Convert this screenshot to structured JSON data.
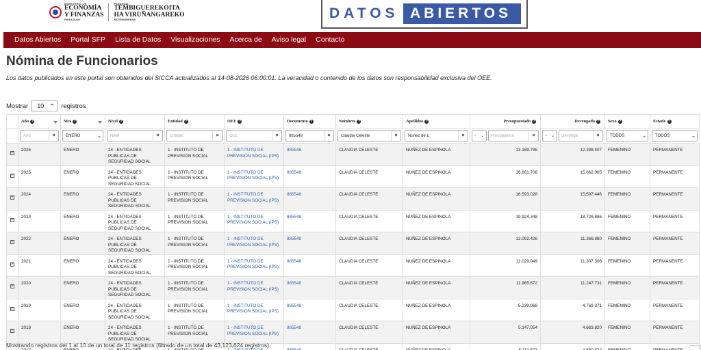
{
  "header": {
    "mef_small": "MINISTERIO DE",
    "mef_line1": "ECONOMÍA",
    "mef_line2": "Y FINANZAS",
    "mef_country": "PARAGUAY",
    "guar_small": "PARAGUÁI",
    "guar_line1": "TEMBIGUEREKOITA",
    "guar_line2": "HA VIRUÑANGAREKO",
    "guar_foot": "MOTENONDEHA",
    "banner_word1": "DATOS",
    "banner_word2": "ABIERTOS"
  },
  "nav": [
    "Datos Abiertos",
    "Portal SFP",
    "Lista de Datos",
    "Visualizaciones",
    "Acerca de",
    "Aviso legal",
    "Contacto"
  ],
  "page": {
    "title": "Nómina de Funcionarios",
    "description": "Los datos publicados en este portal son obtenidos del SICCA actualizados al 14-08-2026 06:00:01. La veracidad o contenido de los datos son responsabilidad exclusiva del OEE.",
    "show_label": "Mostrar",
    "show_value": "10",
    "show_suffix": "registros",
    "info": "Mostrando registros del 1 al 10 de un total de 11 registros (filtrado de un total de 43,123,624 registros)."
  },
  "columns": [
    "Año",
    "Mes",
    "Nivel",
    "Entidad",
    "OEE",
    "Documento",
    "Nombres",
    "Apellidos",
    "Presupuestado",
    "Devengado",
    "Sexo",
    "Estado"
  ],
  "filters": {
    "anio_placeholder": "Año",
    "mes_value": "ENERO",
    "nivel_placeholder": "Nivel",
    "entidad_placeholder": "Entidad",
    "oee_placeholder": "OEE",
    "documento_value": "885548",
    "nombres_value": "Claudia Celeste",
    "apellidos_value": "Nuñez de E",
    "presupuestado_op": "=",
    "presupuestado_placeholder": "Presupuesta",
    "devengado_op": "=",
    "devengado_placeholder": "Devenga",
    "sexo_value": "TODOS",
    "estado_value": "TODOS"
  },
  "rows": [
    {
      "anio": "2026",
      "mes": "ENERO",
      "nivel": "24 - ENTIDADES PUBLICAS DE SEGURIDAD SOCIAL",
      "entidad": "1 - INSTITUTO DE PREVISION SOCIAL",
      "oee": "1 - INSTITUTO DE PREVISION SOCIAL (IPS)",
      "documento": "885548",
      "nombres": "CLAUDIA CELESTE",
      "apellidos": "NUÑEZ DE ESPINOLA",
      "presupuestado": "13.189.795",
      "devengado": "12.398.407",
      "sexo": "FEMENINO",
      "estado": "PERMANENTE"
    },
    {
      "anio": "2025",
      "mes": "ENERO",
      "nivel": "24 - ENTIDADES PUBLICAS DE SEGURIDAD SOCIAL",
      "entidad": "1 - INSTITUTO DE PREVISION SOCIAL",
      "oee": "1 - INSTITUTO DE PREVISION SOCIAL (IPS)",
      "documento": "885548",
      "nombres": "CLAUDIA CELESTE",
      "apellidos": "NUÑEZ DE ESPINOLA",
      "presupuestado": "16.661.708",
      "devengado": "15.662.005",
      "sexo": "FEMENINO",
      "estado": "PERMANENTE"
    },
    {
      "anio": "2024",
      "mes": "ENERO",
      "nivel": "24 - ENTIDADES PUBLICAS DE SEGURIDAD SOCIAL",
      "entidad": "1 - INSTITUTO DE PREVISION SOCIAL",
      "oee": "1 - INSTITUTO DE PREVISION SOCIAL (IPS)",
      "documento": "885548",
      "nombres": "CLAUDIA CELESTE",
      "apellidos": "NUÑEZ DE ESPINOLA",
      "presupuestado": "16.593.028",
      "devengado": "15.597.446",
      "sexo": "FEMENINO",
      "estado": "PERMANENTE"
    },
    {
      "anio": "2023",
      "mes": "ENERO",
      "nivel": "24 - ENTIDADES PUBLICAS DE SEGURIDAD SOCIAL",
      "entidad": "1 - INSTITUTO DE PREVISION SOCIAL",
      "oee": "1 - INSTITUTO DE PREVISION SOCIAL (IPS)",
      "documento": "885548",
      "nombres": "CLAUDIA CELESTE",
      "apellidos": "NUÑEZ DE ESPINOLA",
      "presupuestado": "19.924.348",
      "devengado": "18.728.886",
      "sexo": "FEMENINO",
      "estado": "PERMANENTE"
    },
    {
      "anio": "2022",
      "mes": "ENERO",
      "nivel": "24 - ENTIDADES PUBLICAS DE SEGURIDAD SOCIAL",
      "entidad": "1 - INSTITUTO DE PREVISION SOCIAL",
      "oee": "1 - INSTITUTO DE PREVISION SOCIAL (IPS)",
      "documento": "885548",
      "nombres": "CLAUDIA CELESTE",
      "apellidos": "NUÑEZ DE ESPINOLA",
      "presupuestado": "12.092.426",
      "devengado": "11.366.880",
      "sexo": "FEMENINO",
      "estado": "PERMANENTE"
    },
    {
      "anio": "2021",
      "mes": "ENERO",
      "nivel": "24 - ENTIDADES PUBLICAS DE SEGURIDAD SOCIAL",
      "entidad": "1 - INSTITUTO DE PREVISION SOCIAL",
      "oee": "1 - INSTITUTO DE PREVISION SOCIAL (IPS)",
      "documento": "885548",
      "nombres": "CLAUDIA CELESTE",
      "apellidos": "NUÑEZ DE ESPINOLA",
      "presupuestado": "12.029.049",
      "devengado": "11.307.306",
      "sexo": "FEMENINO",
      "estado": "PERMANENTE"
    },
    {
      "anio": "2020",
      "mes": "ENERO",
      "nivel": "24 - ENTIDADES PUBLICAS DE SEGURIDAD SOCIAL",
      "entidad": "1 - INSTITUTO DE PREVISION SOCIAL",
      "oee": "1 - INSTITUTO DE PREVISION SOCIAL (IPS)",
      "documento": "885548",
      "nombres": "CLAUDIA CELESTE",
      "apellidos": "NUÑEZ DE ESPINOLA",
      "presupuestado": "11.965.672",
      "devengado": "11.247.731",
      "sexo": "FEMENINO",
      "estado": "PERMANENTE"
    },
    {
      "anio": "2019",
      "mes": "ENERO",
      "nivel": "24 - ENTIDADES PUBLICAS DE SEGURIDAD SOCIAL",
      "entidad": "1 - INSTITUTO DE PREVISION SOCIAL",
      "oee": "1 - INSTITUTO DE PREVISION SOCIAL (IPS)",
      "documento": "885548",
      "nombres": "CLAUDIA CELESTE",
      "apellidos": "NUÑEZ DE ESPINOLA",
      "presupuestado": "5.239.968",
      "devengado": "4.769.371",
      "sexo": "FEMENINO",
      "estado": "PERMANENTE"
    },
    {
      "anio": "2018",
      "mes": "ENERO",
      "nivel": "24 - ENTIDADES PUBLICAS DE SEGURIDAD SOCIAL",
      "entidad": "1 - INSTITUTO DE PREVISION SOCIAL",
      "oee": "1 - INSTITUTO DE PREVISION SOCIAL (IPS)",
      "documento": "885548",
      "nombres": "CLAUDIA CELESTE",
      "apellidos": "NUÑEZ DE ESPINOLA",
      "presupuestado": "5.147.054",
      "devengado": "4.683.820",
      "sexo": "FEMENINO",
      "estado": "PERMANENTE"
    },
    {
      "anio": "2017",
      "mes": "ENERO",
      "nivel": "24 - ENTIDADES PUBLICAS DE SEGURIDAD SOCIAL",
      "entidad": "1 - INSTITUTO DE PREVISION SOCIAL",
      "oee": "1 - INSTITUTO DE PREVISION SOCIAL (IPS)",
      "documento": "885548",
      "nombres": "CLAUDIA CELESTE",
      "apellidos": "NUÑEZ DE ESPINOLA",
      "presupuestado": "5.110.573",
      "devengado": "4.650.622",
      "sexo": "FEMENINO",
      "estado": "PERMANENTE"
    }
  ],
  "icons": {
    "clear": "×",
    "expand": "+",
    "help": "?",
    "chevron": "⌄"
  },
  "colors": {
    "nav_bg": "#8b0a14",
    "banner_blue": "#3a5aa8",
    "link": "#2a5fa8"
  }
}
